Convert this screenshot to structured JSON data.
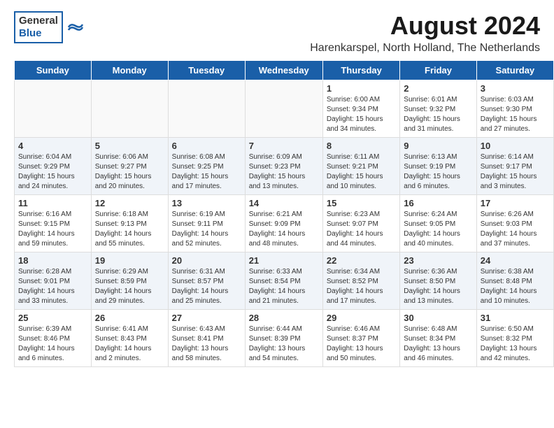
{
  "header": {
    "month_year": "August 2024",
    "location": "Harenkarspel, North Holland, The Netherlands",
    "logo_general": "General",
    "logo_blue": "Blue"
  },
  "weekdays": [
    "Sunday",
    "Monday",
    "Tuesday",
    "Wednesday",
    "Thursday",
    "Friday",
    "Saturday"
  ],
  "weeks": [
    [
      {
        "day": "",
        "info": ""
      },
      {
        "day": "",
        "info": ""
      },
      {
        "day": "",
        "info": ""
      },
      {
        "day": "",
        "info": ""
      },
      {
        "day": "1",
        "info": "Sunrise: 6:00 AM\nSunset: 9:34 PM\nDaylight: 15 hours\nand 34 minutes."
      },
      {
        "day": "2",
        "info": "Sunrise: 6:01 AM\nSunset: 9:32 PM\nDaylight: 15 hours\nand 31 minutes."
      },
      {
        "day": "3",
        "info": "Sunrise: 6:03 AM\nSunset: 9:30 PM\nDaylight: 15 hours\nand 27 minutes."
      }
    ],
    [
      {
        "day": "4",
        "info": "Sunrise: 6:04 AM\nSunset: 9:29 PM\nDaylight: 15 hours\nand 24 minutes."
      },
      {
        "day": "5",
        "info": "Sunrise: 6:06 AM\nSunset: 9:27 PM\nDaylight: 15 hours\nand 20 minutes."
      },
      {
        "day": "6",
        "info": "Sunrise: 6:08 AM\nSunset: 9:25 PM\nDaylight: 15 hours\nand 17 minutes."
      },
      {
        "day": "7",
        "info": "Sunrise: 6:09 AM\nSunset: 9:23 PM\nDaylight: 15 hours\nand 13 minutes."
      },
      {
        "day": "8",
        "info": "Sunrise: 6:11 AM\nSunset: 9:21 PM\nDaylight: 15 hours\nand 10 minutes."
      },
      {
        "day": "9",
        "info": "Sunrise: 6:13 AM\nSunset: 9:19 PM\nDaylight: 15 hours\nand 6 minutes."
      },
      {
        "day": "10",
        "info": "Sunrise: 6:14 AM\nSunset: 9:17 PM\nDaylight: 15 hours\nand 3 minutes."
      }
    ],
    [
      {
        "day": "11",
        "info": "Sunrise: 6:16 AM\nSunset: 9:15 PM\nDaylight: 14 hours\nand 59 minutes."
      },
      {
        "day": "12",
        "info": "Sunrise: 6:18 AM\nSunset: 9:13 PM\nDaylight: 14 hours\nand 55 minutes."
      },
      {
        "day": "13",
        "info": "Sunrise: 6:19 AM\nSunset: 9:11 PM\nDaylight: 14 hours\nand 52 minutes."
      },
      {
        "day": "14",
        "info": "Sunrise: 6:21 AM\nSunset: 9:09 PM\nDaylight: 14 hours\nand 48 minutes."
      },
      {
        "day": "15",
        "info": "Sunrise: 6:23 AM\nSunset: 9:07 PM\nDaylight: 14 hours\nand 44 minutes."
      },
      {
        "day": "16",
        "info": "Sunrise: 6:24 AM\nSunset: 9:05 PM\nDaylight: 14 hours\nand 40 minutes."
      },
      {
        "day": "17",
        "info": "Sunrise: 6:26 AM\nSunset: 9:03 PM\nDaylight: 14 hours\nand 37 minutes."
      }
    ],
    [
      {
        "day": "18",
        "info": "Sunrise: 6:28 AM\nSunset: 9:01 PM\nDaylight: 14 hours\nand 33 minutes."
      },
      {
        "day": "19",
        "info": "Sunrise: 6:29 AM\nSunset: 8:59 PM\nDaylight: 14 hours\nand 29 minutes."
      },
      {
        "day": "20",
        "info": "Sunrise: 6:31 AM\nSunset: 8:57 PM\nDaylight: 14 hours\nand 25 minutes."
      },
      {
        "day": "21",
        "info": "Sunrise: 6:33 AM\nSunset: 8:54 PM\nDaylight: 14 hours\nand 21 minutes."
      },
      {
        "day": "22",
        "info": "Sunrise: 6:34 AM\nSunset: 8:52 PM\nDaylight: 14 hours\nand 17 minutes."
      },
      {
        "day": "23",
        "info": "Sunrise: 6:36 AM\nSunset: 8:50 PM\nDaylight: 14 hours\nand 13 minutes."
      },
      {
        "day": "24",
        "info": "Sunrise: 6:38 AM\nSunset: 8:48 PM\nDaylight: 14 hours\nand 10 minutes."
      }
    ],
    [
      {
        "day": "25",
        "info": "Sunrise: 6:39 AM\nSunset: 8:46 PM\nDaylight: 14 hours\nand 6 minutes."
      },
      {
        "day": "26",
        "info": "Sunrise: 6:41 AM\nSunset: 8:43 PM\nDaylight: 14 hours\nand 2 minutes."
      },
      {
        "day": "27",
        "info": "Sunrise: 6:43 AM\nSunset: 8:41 PM\nDaylight: 13 hours\nand 58 minutes."
      },
      {
        "day": "28",
        "info": "Sunrise: 6:44 AM\nSunset: 8:39 PM\nDaylight: 13 hours\nand 54 minutes."
      },
      {
        "day": "29",
        "info": "Sunrise: 6:46 AM\nSunset: 8:37 PM\nDaylight: 13 hours\nand 50 minutes."
      },
      {
        "day": "30",
        "info": "Sunrise: 6:48 AM\nSunset: 8:34 PM\nDaylight: 13 hours\nand 46 minutes."
      },
      {
        "day": "31",
        "info": "Sunrise: 6:50 AM\nSunset: 8:32 PM\nDaylight: 13 hours\nand 42 minutes."
      }
    ]
  ]
}
